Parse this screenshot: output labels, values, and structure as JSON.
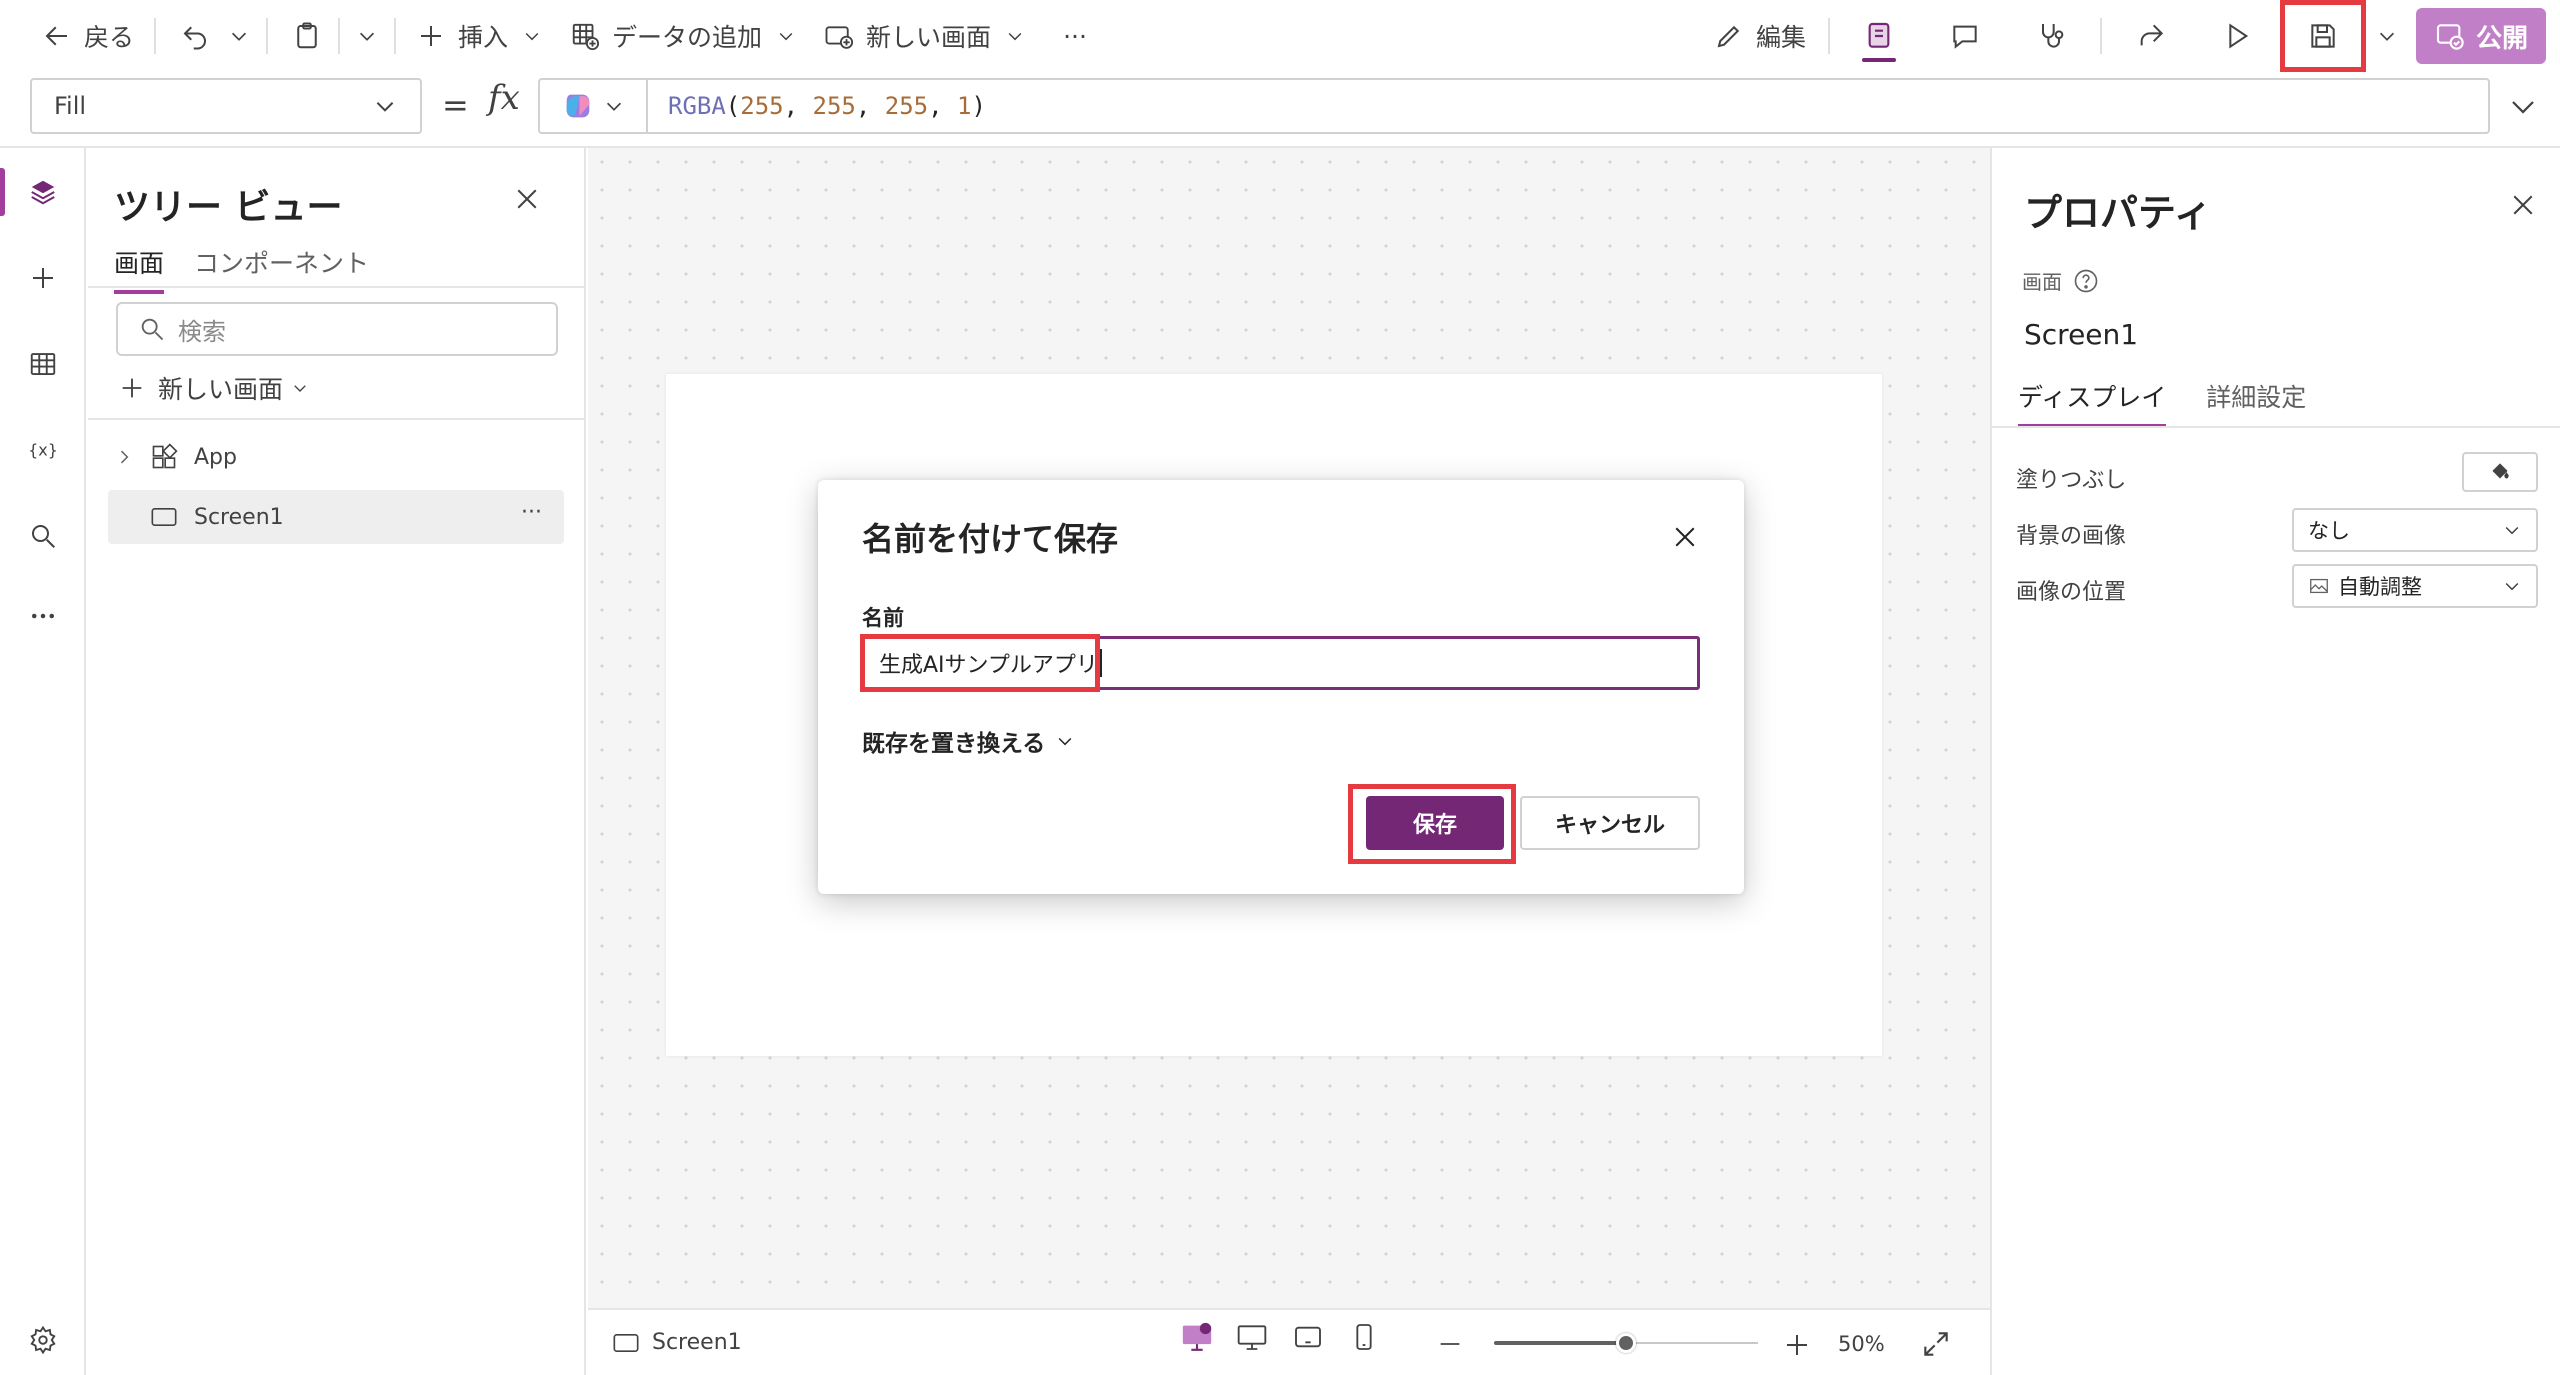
{
  "toolbar": {
    "back_label": "戻る",
    "insert_label": "挿入",
    "add_data_label": "データの追加",
    "new_screen_label": "新しい画面",
    "more_label": "···",
    "edit_label": "編集",
    "publish_label": "公開"
  },
  "formula_bar": {
    "property": "Fill",
    "equals": "=",
    "fx": "fx",
    "fn": "RGBA",
    "open": "(",
    "args": [
      "255",
      "255",
      "255",
      "1"
    ],
    "sep": ", ",
    "close": ")"
  },
  "tree_view": {
    "title": "ツリー ビュー",
    "tabs": [
      "画面",
      "コンポーネント"
    ],
    "search_placeholder": "検索",
    "new_screen": "新しい画面",
    "items": [
      {
        "label": "App"
      },
      {
        "label": "Screen1",
        "more": "···"
      }
    ]
  },
  "properties": {
    "title": "プロパティ",
    "kind": "画面",
    "screen_name": "Screen1",
    "tabs": [
      "ディスプレイ",
      "詳細設定"
    ],
    "rows": [
      {
        "label": "塗りつぶし"
      },
      {
        "label": "背景の画像",
        "value": "なし"
      },
      {
        "label": "画像の位置",
        "value": "自動調整"
      }
    ]
  },
  "status_bar": {
    "screen_label": "Screen1",
    "zoom_percent": "50%",
    "zoom_level": 0.5
  },
  "dialog": {
    "title": "名前を付けて保存",
    "name_label": "名前",
    "name_value": "生成AIサンプルアプリ",
    "replace_label": "既存を置き換える",
    "save_label": "保存",
    "cancel_label": "キャンセル"
  },
  "colors": {
    "accent": "#742774",
    "publish": "#c17fc8",
    "highlight": "#e53a40"
  }
}
